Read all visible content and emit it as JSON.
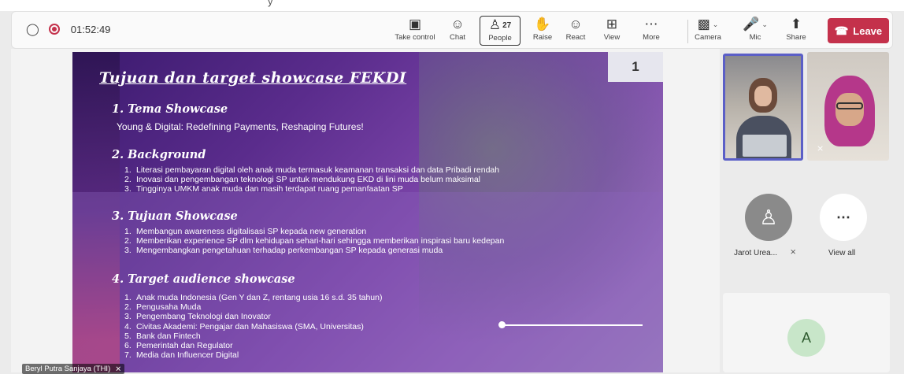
{
  "top_fragment": "y",
  "toolbar": {
    "timer": "01:52:49",
    "buttons": {
      "take_control": "Take control",
      "chat": "Chat",
      "people": "People",
      "people_count": "27",
      "raise": "Raise",
      "react": "React",
      "view": "View",
      "more": "More",
      "camera": "Camera",
      "mic": "Mic",
      "share": "Share",
      "leave": "Leave"
    }
  },
  "slide": {
    "number": "1",
    "title": "Tujuan dan target showcase FEKDI",
    "sections": [
      {
        "heading": "1. Tema Showcase",
        "text": "Young & Digital: Redefining Payments, Reshaping Futures!"
      },
      {
        "heading": "2. Background",
        "items": [
          "Literasi pembayaran digital oleh anak muda termasuk keamanan transaksi dan data Pribadi rendah",
          "Inovasi dan pengembangan teknologi SP untuk mendukung EKD di lini muda belum maksimal",
          "Tingginya UMKM anak muda dan masih terdapat ruang pemanfaatan SP"
        ]
      },
      {
        "heading": "3. Tujuan Showcase",
        "items": [
          "Membangun awareness digitalisasi SP kepada new generation",
          "Memberikan experience SP dlm kehidupan sehari-hari sehingga memberikan inspirasi baru kedepan",
          "Mengembangkan pengetahuan terhadap perkembangan SP kepada generasi muda"
        ]
      },
      {
        "heading": "4. Target audience showcase",
        "items": [
          "Anak muda Indonesia (Gen Y dan Z, rentang usia 16 s.d. 35 tahun)",
          "Pengusaha Muda",
          "Pengembang Teknologi dan Inovator",
          "Civitas Akademi: Pengajar dan Mahasiswa (SMA, Universitas)",
          "Bank dan Fintech",
          "Pemerintah dan Regulator",
          "Media dan Influencer Digital"
        ]
      }
    ]
  },
  "presenter_name": "Beryl Putra Sanjaya (THI)",
  "participants": {
    "jarot_label": "Jarot Urea...",
    "view_all": "View all",
    "a_initial": "A"
  },
  "colors": {
    "accent": "#5b5fc7",
    "leave": "#c4314b"
  }
}
